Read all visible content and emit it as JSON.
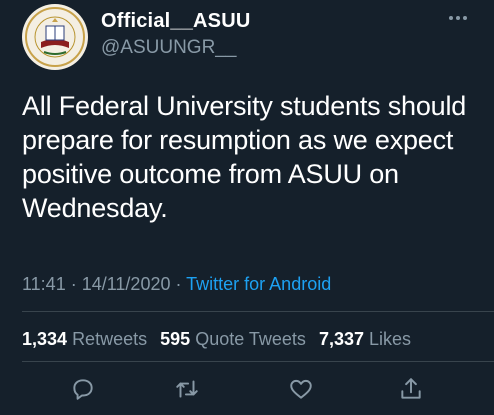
{
  "author": {
    "name": "Official__ASUU",
    "handle": "@ASUUNGR__",
    "avatar_icon": "union-seal-logo"
  },
  "tweet": {
    "text": "All Federal University students should\nprepare for resumption as we expect\npositive outcome from ASUU on\nWednesday."
  },
  "meta": {
    "time": "11:41",
    "separator1": " · ",
    "date": "14/11/2020",
    "separator2": " · ",
    "source": "Twitter for Android"
  },
  "stats": {
    "retweets_count": "1,334",
    "retweets_label": "Retweets",
    "quotes_count": "595",
    "quotes_label": "Quote Tweets",
    "likes_count": "7,337",
    "likes_label": "Likes"
  },
  "actions": {
    "icons": [
      "reply-icon",
      "retweet-icon",
      "like-icon",
      "share-icon"
    ]
  },
  "colors": {
    "background": "#15202b",
    "text": "#ffffff",
    "secondary": "#8899a6",
    "link": "#1da1f2",
    "divider": "#38444d"
  }
}
